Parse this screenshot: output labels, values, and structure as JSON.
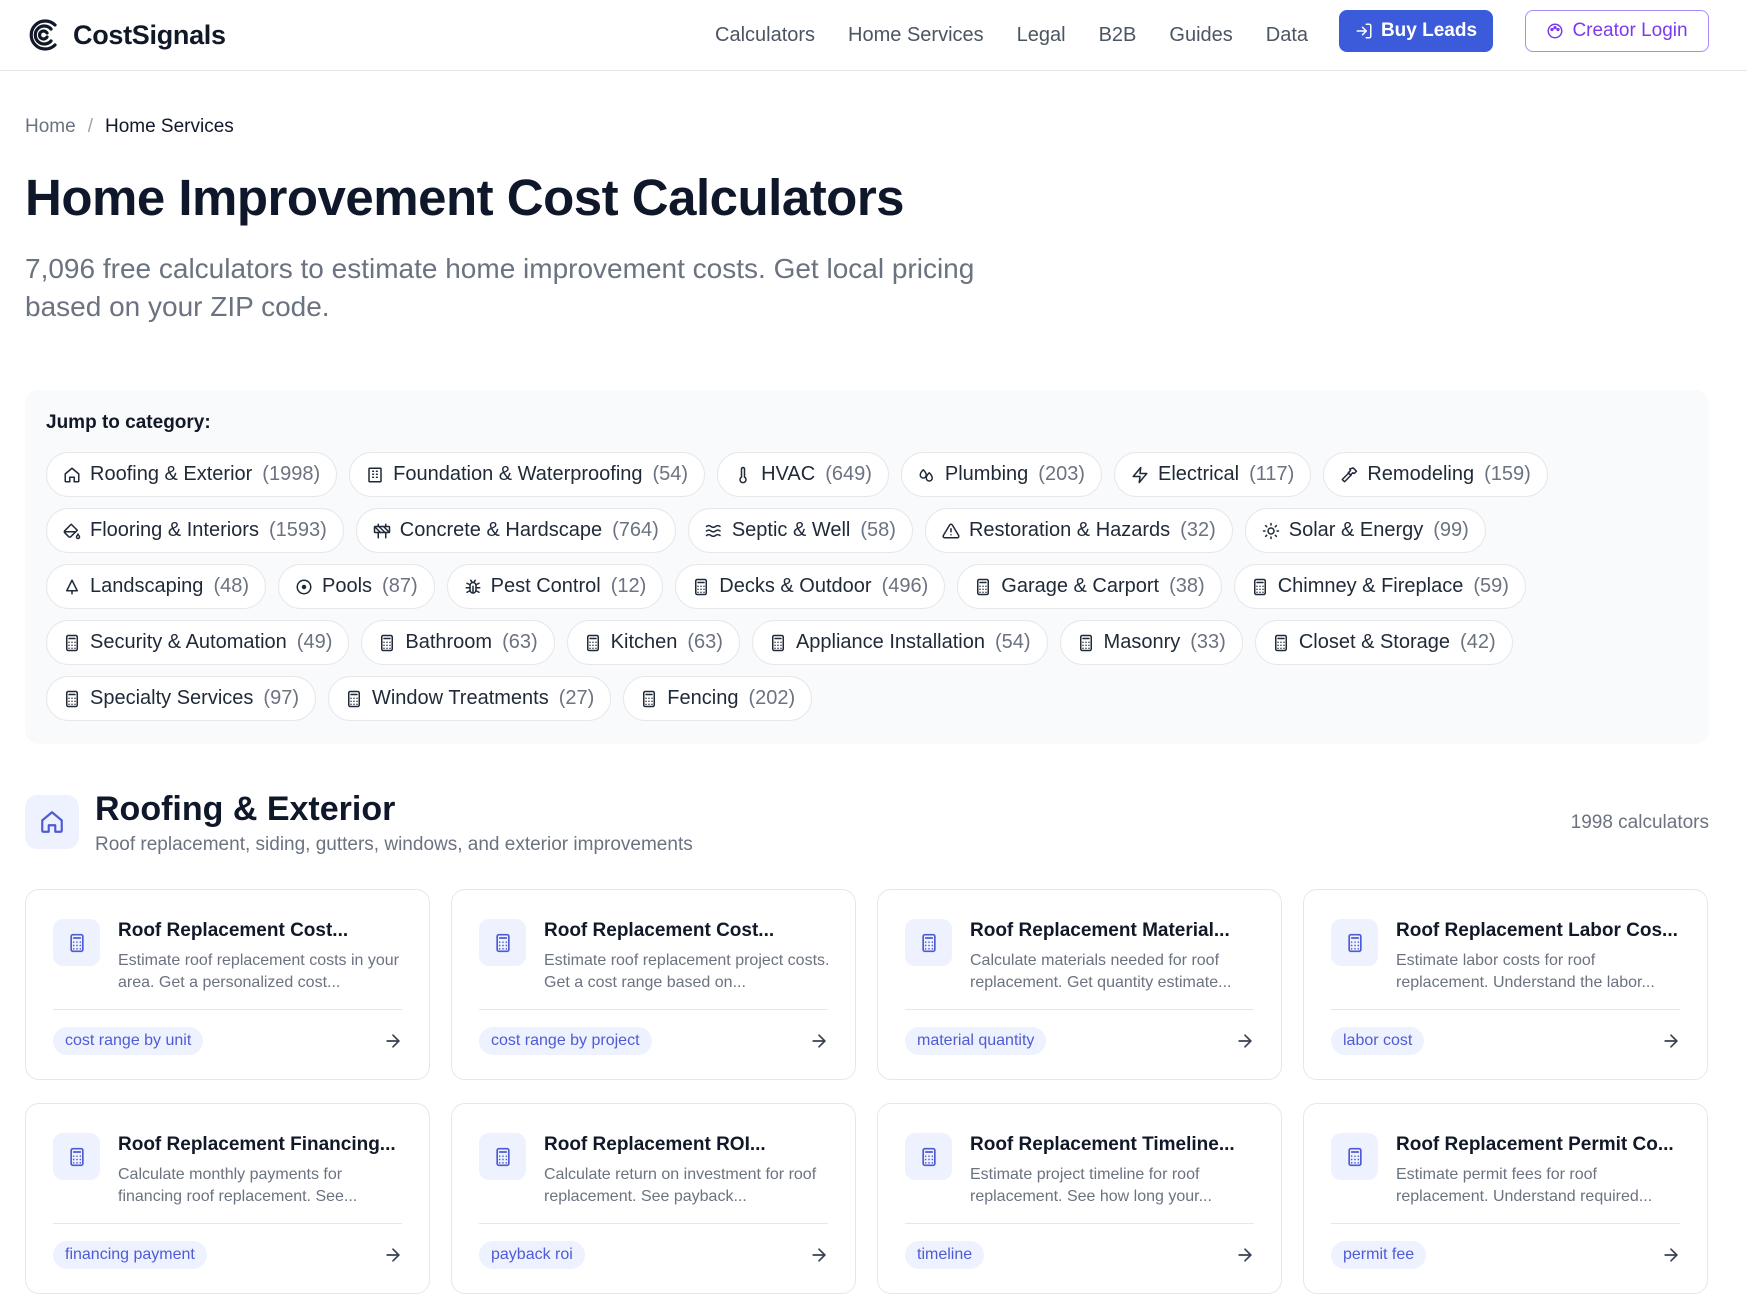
{
  "brand": {
    "name": "CostSignals",
    "logo_icon": "c-signal-logo-icon"
  },
  "nav": {
    "items": [
      "Calculators",
      "Home Services",
      "Legal",
      "B2B",
      "Guides",
      "Data"
    ],
    "buy_leads_label": "Buy Leads",
    "creator_login_label": "Creator Login",
    "accent_color": "#3b5bdb",
    "creator_color": "#7c3aed"
  },
  "breadcrumb": {
    "home": "Home",
    "separator": "/",
    "current": "Home Services"
  },
  "page": {
    "title": "Home Improvement Cost Calculators",
    "subtitle": "7,096 free calculators to estimate home improvement costs. Get local pricing based on your ZIP code."
  },
  "categories": {
    "heading": "Jump to category:",
    "rows": [
      [
        {
          "icon": "home-icon",
          "label": "Roofing & Exterior",
          "count": "(1998)"
        },
        {
          "icon": "building-icon",
          "label": "Foundation & Waterproofing",
          "count": "(54)"
        },
        {
          "icon": "thermometer-icon",
          "label": "HVAC",
          "count": "(649)"
        },
        {
          "icon": "droplets-icon",
          "label": "Plumbing",
          "count": "(203)"
        },
        {
          "icon": "zap-icon",
          "label": "Electrical",
          "count": "(117)"
        },
        {
          "icon": "hammer-icon",
          "label": "Remodeling",
          "count": "(159)"
        }
      ],
      [
        {
          "icon": "paint-bucket-icon",
          "label": "Flooring & Interiors",
          "count": "(1593)"
        },
        {
          "icon": "construction-icon",
          "label": "Concrete & Hardscape",
          "count": "(764)"
        },
        {
          "icon": "waves-icon",
          "label": "Septic & Well",
          "count": "(58)"
        },
        {
          "icon": "alert-triangle-icon",
          "label": "Restoration & Hazards",
          "count": "(32)"
        },
        {
          "icon": "sun-icon",
          "label": "Solar & Energy",
          "count": "(99)"
        }
      ],
      [
        {
          "icon": "tree-icon",
          "label": "Landscaping",
          "count": "(48)"
        },
        {
          "icon": "circle-dot-icon",
          "label": "Pools",
          "count": "(87)"
        },
        {
          "icon": "bug-icon",
          "label": "Pest Control",
          "count": "(12)"
        },
        {
          "icon": "calculator-icon",
          "label": "Decks & Outdoor",
          "count": "(496)"
        },
        {
          "icon": "calculator-icon",
          "label": "Garage & Carport",
          "count": "(38)"
        },
        {
          "icon": "calculator-icon",
          "label": "Chimney & Fireplace",
          "count": "(59)"
        }
      ],
      [
        {
          "icon": "calculator-icon",
          "label": "Security & Automation",
          "count": "(49)"
        },
        {
          "icon": "calculator-icon",
          "label": "Bathroom",
          "count": "(63)"
        },
        {
          "icon": "calculator-icon",
          "label": "Kitchen",
          "count": "(63)"
        },
        {
          "icon": "calculator-icon",
          "label": "Appliance Installation",
          "count": "(54)"
        },
        {
          "icon": "calculator-icon",
          "label": "Masonry",
          "count": "(33)"
        },
        {
          "icon": "calculator-icon",
          "label": "Closet & Storage",
          "count": "(42)"
        }
      ],
      [
        {
          "icon": "calculator-icon",
          "label": "Specialty Services",
          "count": "(97)"
        },
        {
          "icon": "calculator-icon",
          "label": "Window Treatments",
          "count": "(27)"
        },
        {
          "icon": "calculator-icon",
          "label": "Fencing",
          "count": "(202)"
        }
      ]
    ]
  },
  "section": {
    "icon": "home-icon",
    "title": "Roofing & Exterior",
    "description": "Roof replacement, siding, gutters, windows, and exterior improvements",
    "count": "1998 calculators",
    "cards": [
      {
        "title": "Roof Replacement Cost...",
        "desc": "Estimate roof replacement costs in your area. Get a personalized cost...",
        "tag": "cost range by unit"
      },
      {
        "title": "Roof Replacement Cost...",
        "desc": "Estimate roof replacement project costs. Get a cost range based on...",
        "tag": "cost range by project"
      },
      {
        "title": "Roof Replacement Material...",
        "desc": "Calculate materials needed for roof replacement. Get quantity estimate...",
        "tag": "material quantity"
      },
      {
        "title": "Roof Replacement Labor Cos...",
        "desc": "Estimate labor costs for roof replacement. Understand the labor...",
        "tag": "labor cost"
      },
      {
        "title": "Roof Replacement Financing...",
        "desc": "Calculate monthly payments for financing roof replacement. See...",
        "tag": "financing payment"
      },
      {
        "title": "Roof Replacement ROI...",
        "desc": "Calculate return on investment for roof replacement. See payback...",
        "tag": "payback roi"
      },
      {
        "title": "Roof Replacement Timeline...",
        "desc": "Estimate project timeline for roof replacement. See how long your...",
        "tag": "timeline"
      },
      {
        "title": "Roof Replacement Permit Co...",
        "desc": "Estimate permit fees for roof replacement. Understand required...",
        "tag": "permit fee"
      }
    ]
  }
}
